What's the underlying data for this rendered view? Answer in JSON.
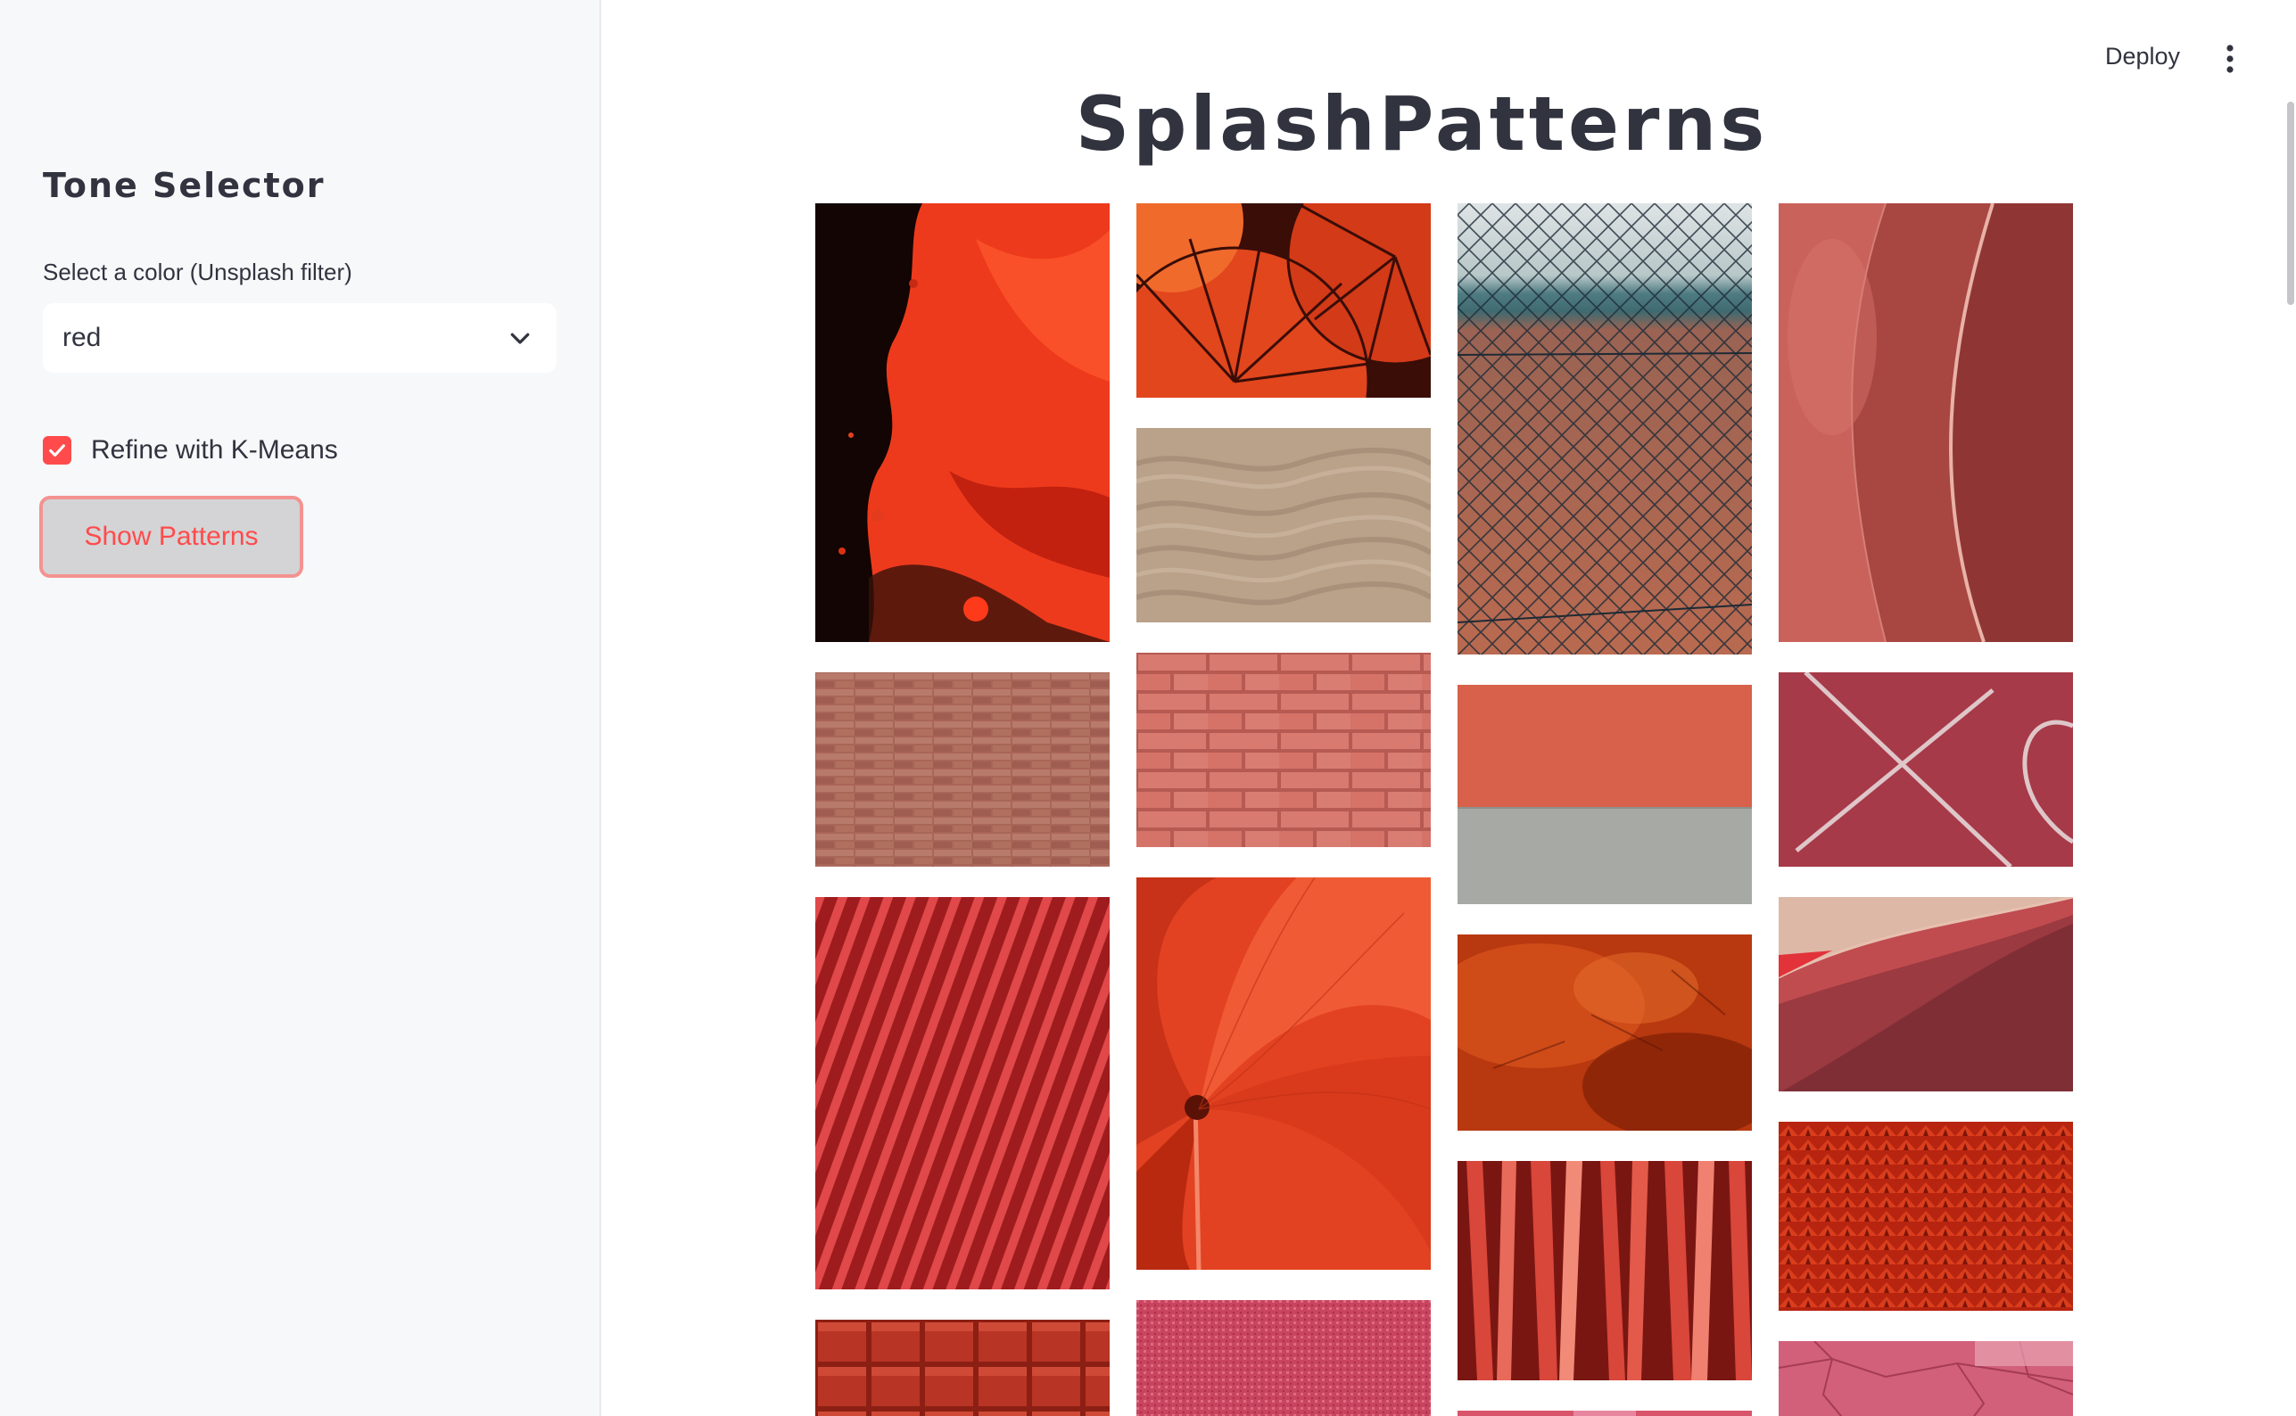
{
  "sidebar": {
    "title": "Tone Selector",
    "select_label": "Select a color (Unsplash filter)",
    "select_value": "red",
    "checkbox_label": "Refine with K-Means",
    "checkbox_checked": true,
    "button_label": "Show Patterns"
  },
  "header": {
    "deploy_label": "Deploy",
    "menu_icon": "vertical-ellipsis-icon"
  },
  "main": {
    "title": "SplashPatterns"
  },
  "colors": {
    "accent": "#ff4b4b",
    "text": "#31333f",
    "sidebar_bg": "#f7f8fa"
  },
  "gallery": {
    "columns": [
      [
        {
          "name": "red-fluid-paint-image",
          "pattern": "fluid"
        },
        {
          "name": "brick-wall-image",
          "pattern": "brick-small"
        },
        {
          "name": "red-diagonal-stripes-image",
          "pattern": "stripes"
        },
        {
          "name": "red-wood-blocks-image",
          "pattern": "blocks"
        }
      ],
      [
        {
          "name": "red-umbrellas-image",
          "pattern": "umbrellas"
        },
        {
          "name": "sand-ripples-image",
          "pattern": "sand"
        },
        {
          "name": "pink-brick-wall-image",
          "pattern": "brick-large"
        },
        {
          "name": "red-hibiscus-image",
          "pattern": "hibiscus"
        },
        {
          "name": "pink-glitter-image",
          "pattern": "glitter"
        }
      ],
      [
        {
          "name": "chain-link-fence-image",
          "pattern": "fence"
        },
        {
          "name": "red-grey-wall-image",
          "pattern": "twotone"
        },
        {
          "name": "rust-abstract-image",
          "pattern": "rust"
        },
        {
          "name": "red-ribbons-image",
          "pattern": "ribbons"
        },
        {
          "name": "pink-panel-image",
          "pattern": "pinkpanel"
        }
      ],
      [
        {
          "name": "pink-silk-fabric-image",
          "pattern": "silk"
        },
        {
          "name": "running-track-lines-image",
          "pattern": "track"
        },
        {
          "name": "red-sand-dune-image",
          "pattern": "dune"
        },
        {
          "name": "red-texture-closeup-image",
          "pattern": "texture"
        },
        {
          "name": "cracked-pink-paint-image",
          "pattern": "cracked"
        }
      ]
    ]
  }
}
